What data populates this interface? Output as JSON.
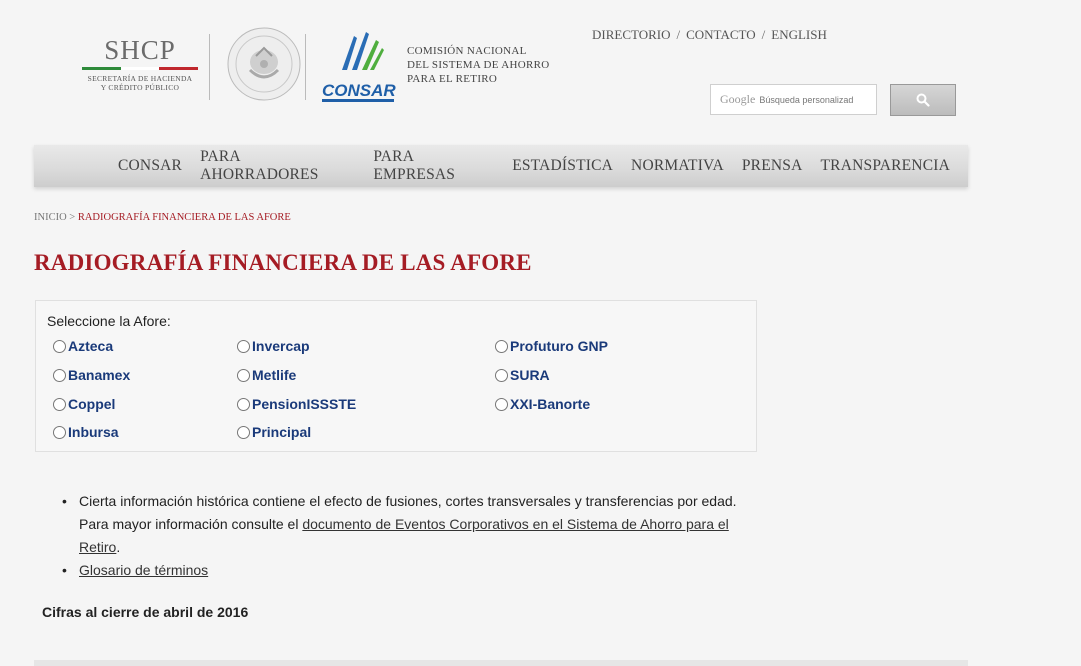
{
  "header": {
    "shcp": {
      "title": "SHCP",
      "subtitle_line1": "SECRETARÍA DE HACIENDA",
      "subtitle_line2": "Y CRÉDITO PÚBLICO",
      "rule_colors": [
        "#2e8b3a",
        "#ffffff",
        "#c0272d"
      ]
    },
    "consar": {
      "logo_text": "CONSAR",
      "name_line1": "COMISIÓN NACIONAL",
      "name_line2": "DEL SISTEMA DE AHORRO",
      "name_line3": "PARA EL RETIRO"
    },
    "top_links": [
      {
        "label": "DIRECTORIO"
      },
      {
        "label": "CONTACTO"
      },
      {
        "label": "ENGLISH"
      }
    ],
    "search": {
      "brand": "Google",
      "placeholder": "Búsqueda personalizad",
      "button_icon": "search-icon"
    }
  },
  "nav": {
    "items": [
      {
        "label": "CONSAR"
      },
      {
        "label": "PARA AHORRADORES"
      },
      {
        "label": "PARA EMPRESAS"
      },
      {
        "label": "ESTADÍSTICA"
      },
      {
        "label": "NORMATIVA"
      },
      {
        "label": "PRENSA"
      },
      {
        "label": "TRANSPARENCIA"
      }
    ]
  },
  "breadcrumb": {
    "home": "INICIO",
    "separator": ">",
    "current": "RADIOGRAFÍA FINANCIERA DE LAS AFORE"
  },
  "page": {
    "title": "RADIOGRAFÍA FINANCIERA DE LAS AFORE",
    "accent_color": "#a51c24"
  },
  "afore_selector": {
    "label": "Seleccione la Afore:",
    "options": [
      {
        "label": "Azteca",
        "selected": false
      },
      {
        "label": "Banamex",
        "selected": false
      },
      {
        "label": "Coppel",
        "selected": false
      },
      {
        "label": "Inbursa",
        "selected": false
      },
      {
        "label": "Invercap",
        "selected": false
      },
      {
        "label": "Metlife",
        "selected": false
      },
      {
        "label": "PensionISSSTE",
        "selected": false
      },
      {
        "label": "Principal",
        "selected": false
      },
      {
        "label": "Profuturo GNP",
        "selected": false
      },
      {
        "label": "SURA",
        "selected": false
      },
      {
        "label": "XXI-Banorte",
        "selected": false
      }
    ]
  },
  "info": {
    "item1_text_a": "Cierta información histórica contiene el efecto de fusiones, cortes transversales y transferencias por edad. Para mayor información consulte el ",
    "item1_link": "documento de Eventos Corporativos en el Sistema de Ahorro para el Retiro",
    "item1_text_b": ".",
    "item2_link": "Glosario de términos"
  },
  "cifras": "Cifras al cierre de abril de 2016"
}
